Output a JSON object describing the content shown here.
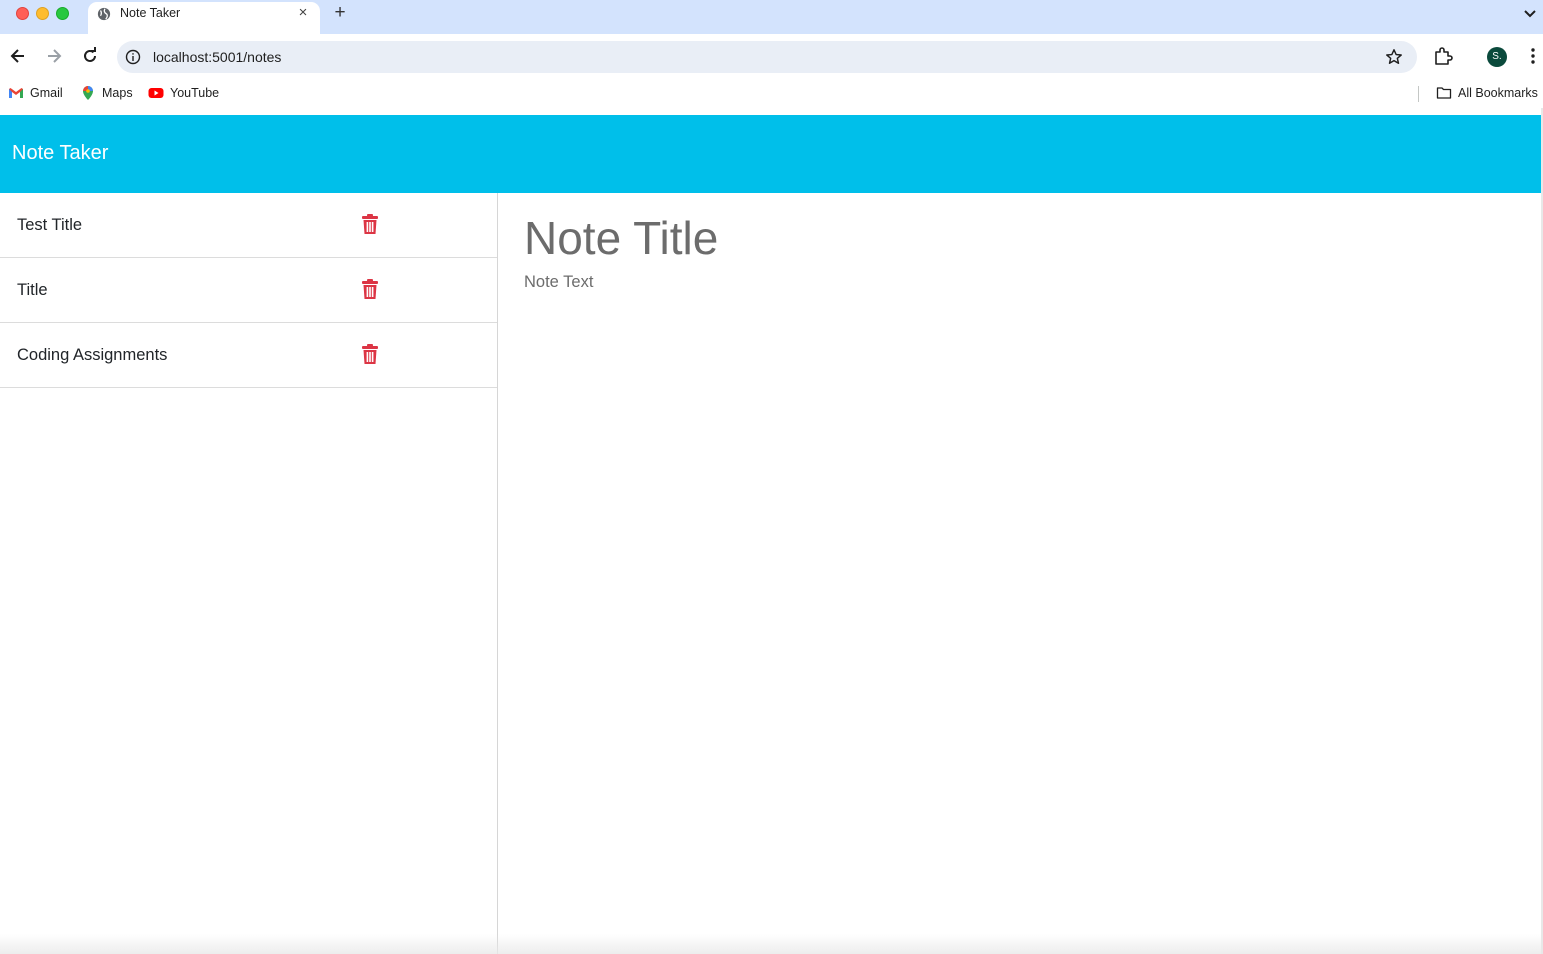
{
  "browser": {
    "tab_title": "Note Taker",
    "tab_close": "×",
    "new_tab": "+",
    "url": "localhost:5001/notes",
    "profile_initial": "S.",
    "bookmarks": [
      {
        "label": "Gmail",
        "icon": "gmail-icon"
      },
      {
        "label": "Maps",
        "icon": "maps-icon"
      },
      {
        "label": "YouTube",
        "icon": "youtube-icon"
      }
    ],
    "all_bookmarks": "All Bookmarks"
  },
  "app": {
    "title": "Note Taker",
    "header_color": "#00bfea",
    "delete_color": "#dc3545"
  },
  "notes": [
    {
      "title": "Test Title"
    },
    {
      "title": "Title"
    },
    {
      "title": "Coding Assignments"
    }
  ],
  "editor": {
    "title_placeholder": "Note Title",
    "text_placeholder": "Note Text"
  }
}
